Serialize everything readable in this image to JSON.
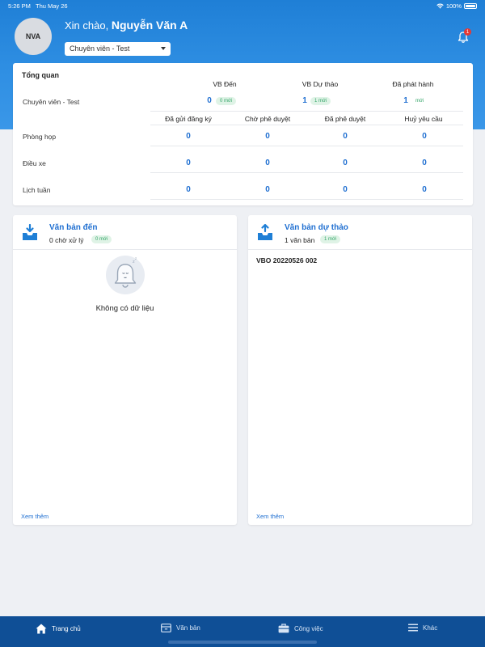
{
  "status_bar": {
    "time": "5:26 PM",
    "date": "Thu May 26",
    "battery": "100%"
  },
  "header": {
    "avatar_initials": "NVA",
    "greeting_prefix": "Xin chào, ",
    "user_name": "Nguyễn Văn A",
    "role_selected": "Chuyên viên - Test",
    "notification_count": "1"
  },
  "overview": {
    "title": "Tổng quan",
    "role_label": "Chuyên viên - Test",
    "doc_columns": [
      {
        "label": "VB Đến",
        "count": "0",
        "chip": "0 mới"
      },
      {
        "label": "VB Dự thảo",
        "count": "1",
        "chip": "1 mới"
      },
      {
        "label": "Đã phát hành",
        "count": "1",
        "chip": "mới"
      }
    ],
    "request_columns": [
      "Đã gửi đăng ký",
      "Chờ phê duyệt",
      "Đã phê duyệt",
      "Huỷ yêu cầu"
    ],
    "rows": [
      {
        "label": "Phòng họp",
        "values": [
          "0",
          "0",
          "0",
          "0"
        ]
      },
      {
        "label": "Điều xe",
        "values": [
          "0",
          "0",
          "0",
          "0"
        ]
      },
      {
        "label": "Lịch tuần",
        "values": [
          "0",
          "0",
          "0",
          "0"
        ]
      }
    ]
  },
  "incoming_card": {
    "title": "Văn bản đến",
    "summary": "0 chờ xử lý",
    "chip": "0 mới",
    "empty_text": "Không có dữ liệu",
    "more_link": "Xem thêm"
  },
  "draft_card": {
    "title": "Văn bản dự thảo",
    "summary": "1 văn bản",
    "chip": "1 mới",
    "items": [
      "VBO 20220526 002"
    ],
    "more_link": "Xem thêm"
  },
  "tabbar": {
    "items": [
      {
        "label": "Trang chủ",
        "icon": "home-icon",
        "active": true
      },
      {
        "label": "Văn bản",
        "icon": "document-icon",
        "active": false
      },
      {
        "label": "Công việc",
        "icon": "briefcase-icon",
        "active": false
      },
      {
        "label": "Khác",
        "icon": "menu-icon",
        "active": false
      }
    ]
  },
  "colors": {
    "primary": "#1f7fd6",
    "link": "#1f6fd1",
    "tabbar": "#0f4f96",
    "chip_text": "#36a66a",
    "chip_bg": "#dff3e6",
    "badge": "#e53935"
  }
}
